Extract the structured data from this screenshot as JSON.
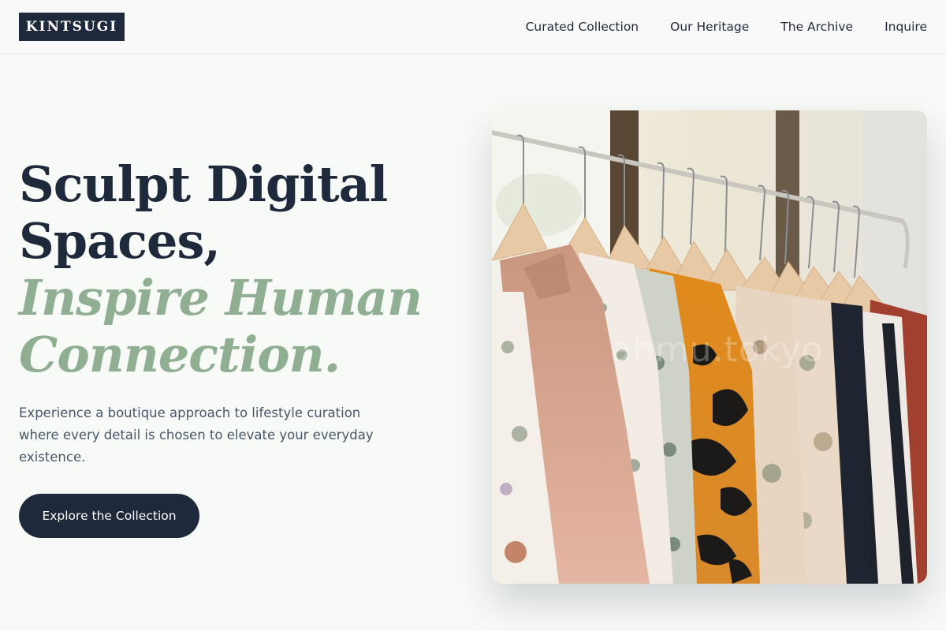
{
  "header": {
    "logo": "KINTSUGI",
    "nav": [
      {
        "label": "Curated Collection"
      },
      {
        "label": "Our Heritage"
      },
      {
        "label": "The Archive"
      },
      {
        "label": "Inquire"
      }
    ]
  },
  "hero": {
    "line1": "Sculpt Digital",
    "line2": "Spaces,",
    "line3": "Inspire Human",
    "line4": "Connection.",
    "subtitle": "Experience a boutique approach to lifestyle curation where every detail is chosen to elevate your everyday existence.",
    "cta": "Explore the Collection"
  },
  "image": {
    "watermark": "ahmu.tokyo",
    "subject": "clothing-rack-photo"
  },
  "colors": {
    "navy": "#1e293b",
    "sage": "#8fae92",
    "background": "#f8faf7",
    "body_text": "#475569"
  }
}
